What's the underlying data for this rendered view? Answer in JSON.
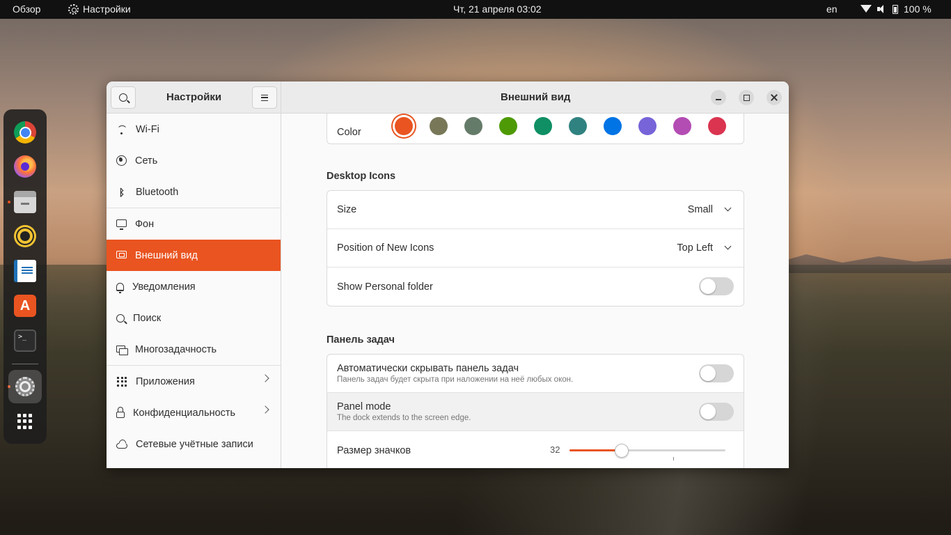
{
  "topbar": {
    "overview": "Обзор",
    "app_name": "Настройки",
    "clock": "Чт, 21 апреля  03:02",
    "language": "en",
    "battery": "100 %"
  },
  "dock": {
    "apps": [
      "chrome-icon",
      "firefox-icon",
      "files-icon",
      "rhythmbox-icon",
      "libreoffice-writer-icon",
      "software-store-icon",
      "terminal-icon",
      "settings-icon",
      "show-apps-icon"
    ]
  },
  "window": {
    "sidebar_title": "Настройки",
    "title": "Внешний вид"
  },
  "sidebar": {
    "items": [
      {
        "label": "Wi-Fi",
        "icon": "wifi-icon"
      },
      {
        "label": "Сеть",
        "icon": "globe-icon"
      },
      {
        "label": "Bluetooth",
        "icon": "bluetooth-icon"
      },
      {
        "label": "Фон",
        "icon": "monitor-icon"
      },
      {
        "label": "Внешний вид",
        "icon": "appearance-icon",
        "active": true
      },
      {
        "label": "Уведомления",
        "icon": "bell-icon"
      },
      {
        "label": "Поиск",
        "icon": "search-icon"
      },
      {
        "label": "Многозадачность",
        "icon": "multitasking-icon"
      },
      {
        "label": "Приложения",
        "icon": "apps-grid-icon",
        "chevron": true
      },
      {
        "label": "Конфиденциальность",
        "icon": "lock-icon",
        "chevron": true
      },
      {
        "label": "Сетевые учётные записи",
        "icon": "cloud-icon"
      }
    ]
  },
  "main": {
    "color": {
      "label": "Color",
      "accents": [
        "#e95420",
        "#787859",
        "#657b69",
        "#4e9a06",
        "#0f8f63",
        "#308280",
        "#0073e5",
        "#7764d8",
        "#b34cb3",
        "#da3450"
      ],
      "selected_index": 0
    },
    "desktop_icons": {
      "title": "Desktop Icons",
      "size_label": "Size",
      "size_value": "Small",
      "position_label": "Position of New Icons",
      "position_value": "Top Left",
      "personal_folder_label": "Show Personal folder",
      "personal_folder_on": false
    },
    "dock": {
      "title": "Панель задач",
      "autohide_label": "Автоматически скрывать панель задач",
      "autohide_sub": "Панель задач будет скрыта при наложении на неё любых окон.",
      "autohide_on": false,
      "panel_mode_label": "Panel mode",
      "panel_mode_sub": "The dock extends to the screen edge.",
      "panel_mode_on": false,
      "icon_size_label": "Размер значков",
      "icon_size_value": "32",
      "icon_size_min": 16,
      "icon_size_max": 64,
      "icon_size_default_mark": 48
    }
  },
  "colors": {
    "accent": "#e95420"
  }
}
